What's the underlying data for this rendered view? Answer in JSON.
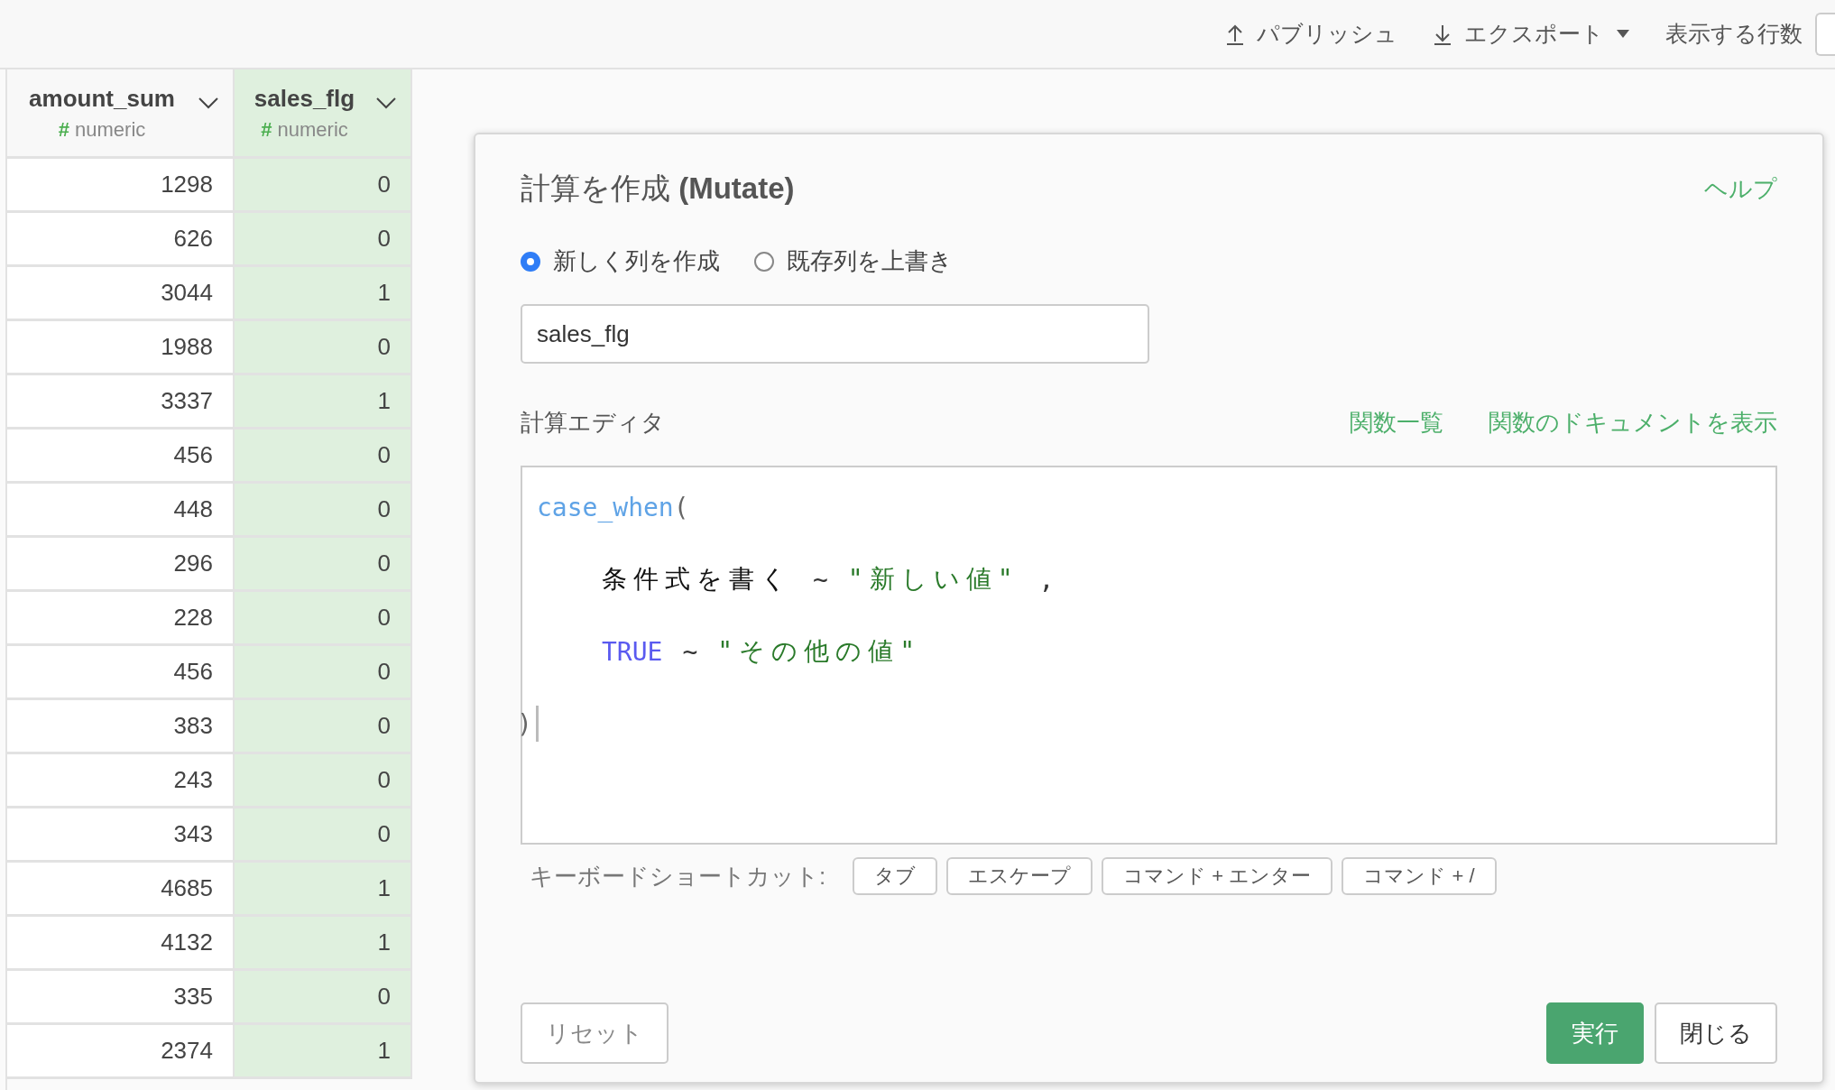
{
  "toolbar": {
    "publish": "パブリッシュ",
    "export": "エクスポート",
    "row_count_label": "表示する行数"
  },
  "table": {
    "columns": [
      {
        "name": "amount_sum",
        "type_icon": "#",
        "type": "numeric",
        "selected": false
      },
      {
        "name": "sales_flg",
        "type_icon": "#",
        "type": "numeric",
        "selected": true
      }
    ],
    "rows": [
      [
        "1298",
        "0"
      ],
      [
        "626",
        "0"
      ],
      [
        "3044",
        "1"
      ],
      [
        "1988",
        "0"
      ],
      [
        "3337",
        "1"
      ],
      [
        "456",
        "0"
      ],
      [
        "448",
        "0"
      ],
      [
        "296",
        "0"
      ],
      [
        "228",
        "0"
      ],
      [
        "456",
        "0"
      ],
      [
        "383",
        "0"
      ],
      [
        "243",
        "0"
      ],
      [
        "343",
        "0"
      ],
      [
        "4685",
        "1"
      ],
      [
        "4132",
        "1"
      ],
      [
        "335",
        "0"
      ],
      [
        "2374",
        "1"
      ]
    ]
  },
  "dialog": {
    "title": "計算を作成 **(Mutate)**",
    "help": "ヘルプ",
    "modes": [
      {
        "label": "新しく列を作成",
        "selected": true
      },
      {
        "label": "既存列を上書き",
        "selected": false
      }
    ],
    "column_name": "sales_flg",
    "editor_label": "計算エディタ",
    "links": [
      "関数一覧",
      "関数のドキュメントを表示"
    ],
    "code_lines": [
      {
        "indent": false,
        "tokens": [
          {
            "kind": "function",
            "text": "case_when"
          },
          {
            "kind": "bracket",
            "text": "("
          }
        ]
      },
      {
        "indent": true,
        "tokens": [
          {
            "kind": "text",
            "text": "条件式を書く"
          },
          {
            "kind": "operator",
            "text": "~"
          },
          {
            "kind": "string",
            "text": "\"新しい値\""
          },
          {
            "kind": "operator",
            "text": ","
          }
        ]
      },
      {
        "indent": true,
        "tokens": [
          {
            "kind": "keyword",
            "text": "TRUE"
          },
          {
            "kind": "operator",
            "text": "~"
          },
          {
            "kind": "string",
            "text": "\"その他の値\""
          }
        ]
      },
      {
        "indent": false,
        "tokens": [
          {
            "kind": "bracket",
            "text": ")"
          }
        ]
      }
    ],
    "shortcuts_label": "キーボードショートカット:",
    "shortcuts": [
      "タブ",
      "エスケープ",
      "コマンド + エンター",
      "コマンド + /"
    ],
    "reset": "リセット",
    "run": "実行",
    "close": "閉じる"
  }
}
